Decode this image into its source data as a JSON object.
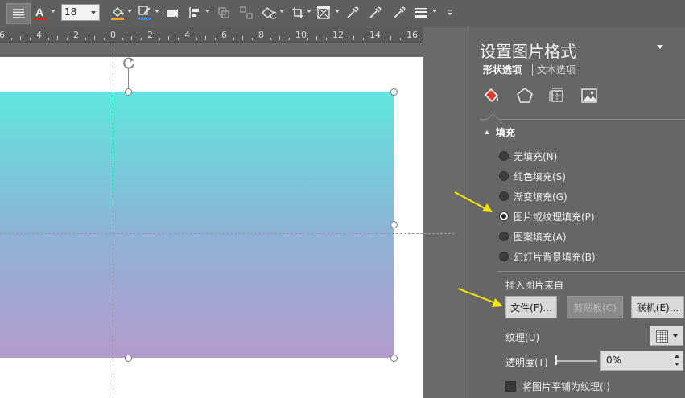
{
  "toolbar": {
    "font_size": "18",
    "icons": [
      "align-justify-icon",
      "font-color-icon",
      "font-size-input",
      "fill-bucket-icon",
      "line-color-icon",
      "shape-effect-icon",
      "align-icon",
      "group-icon",
      "ungroup-icon",
      "rotate-icon",
      "crop-icon",
      "crop-shape-icon",
      "eyedropper-icon",
      "eyedropper-line-icon",
      "eyedropper-fill-icon",
      "line-weight-icon",
      "more-icon"
    ]
  },
  "ruler": {
    "labels": [
      "6",
      "4",
      "2",
      "0",
      "2",
      "4",
      "6",
      "8",
      "10",
      "12",
      "14",
      "16"
    ]
  },
  "pane": {
    "title": "设置图片格式",
    "tab_shape": "形状选项",
    "tab_text": "文本选项",
    "section_fill": "填充",
    "fill_options": [
      {
        "label": "无填充(N)",
        "selected": false
      },
      {
        "label": "纯色填充(S)",
        "selected": false
      },
      {
        "label": "渐变填充(G)",
        "selected": false
      },
      {
        "label": "图片或纹理填充(P)",
        "selected": true
      },
      {
        "label": "图案填充(A)",
        "selected": false
      },
      {
        "label": "幻灯片背景填充(B)",
        "selected": false
      }
    ],
    "insert_from": "插入图片来自",
    "btn_file": "文件(F)...",
    "btn_clipboard": "剪贴板(C)",
    "btn_online": "联机(E)...",
    "texture_label": "纹理(U)",
    "transparency_label": "透明度(T)",
    "transparency_value": "0%",
    "tile_label": "将图片平铺为纹理(I)"
  },
  "colors": {
    "pane_bg": "#666666",
    "accent_arrow": "#f5e600",
    "gradient_top": "#5fe6df",
    "gradient_bottom": "#b49bcd"
  }
}
